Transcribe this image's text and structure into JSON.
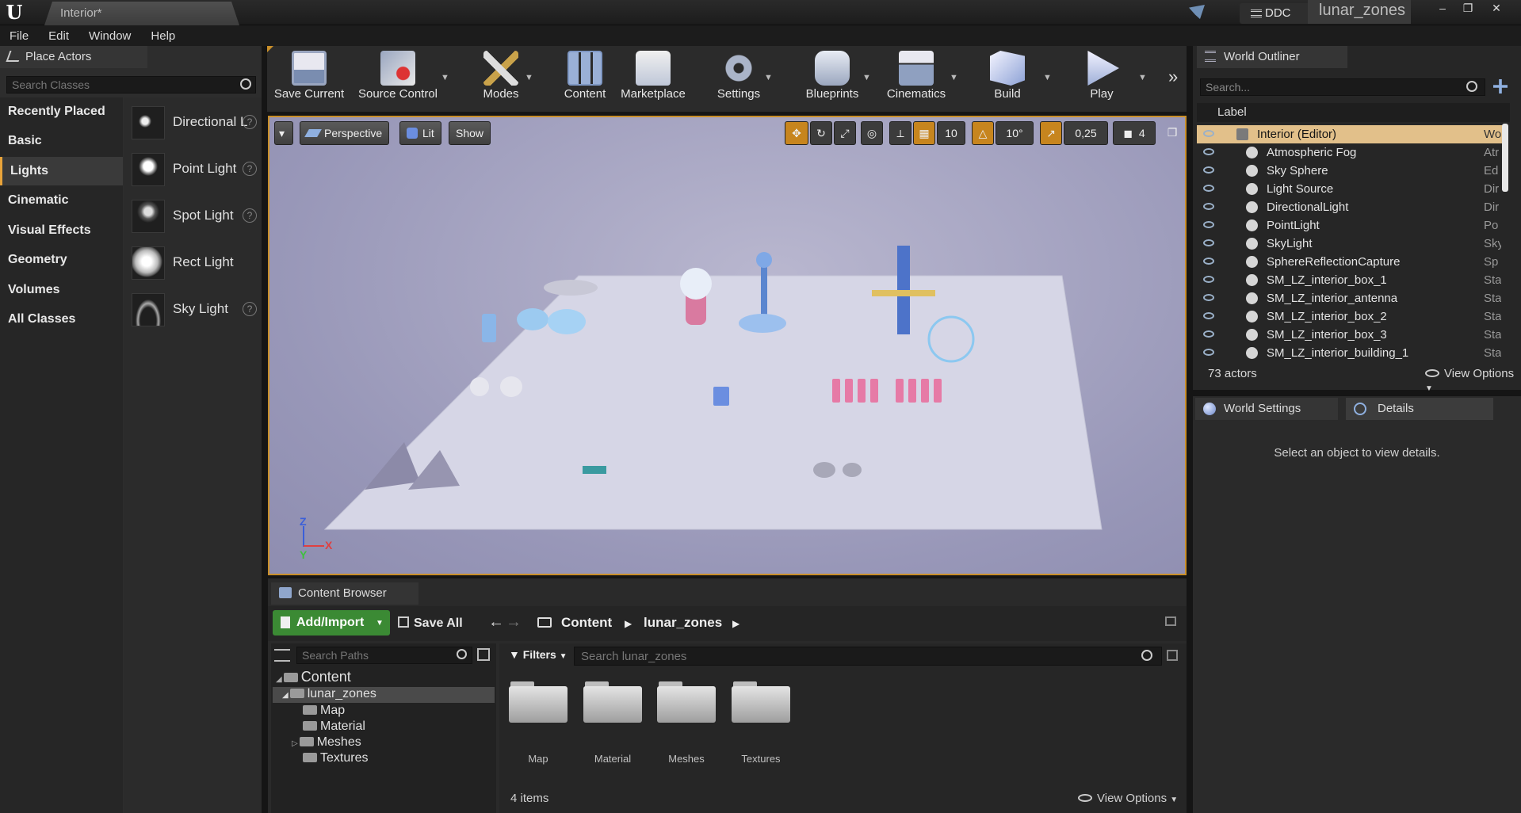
{
  "window": {
    "doc_tab": "Interior*",
    "ddc_label": "DDC",
    "project_name": "lunar_zones",
    "controls": [
      "–",
      "❐",
      "✕"
    ]
  },
  "menu": [
    "File",
    "Edit",
    "Window",
    "Help"
  ],
  "place_actors": {
    "tab_label": "Place Actors",
    "search_placeholder": "Search Classes",
    "categories": [
      "Recently Placed",
      "Basic",
      "Lights",
      "Cinematic",
      "Visual Effects",
      "Geometry",
      "Volumes",
      "All Classes"
    ],
    "active_category": "Lights",
    "items": [
      "Directional Light",
      "Point Light",
      "Spot Light",
      "Rect Light",
      "Sky Light"
    ]
  },
  "toolbar": {
    "buttons": [
      "Save Current",
      "Source Control",
      "Modes",
      "Content",
      "Marketplace",
      "Settings",
      "Blueprints",
      "Cinematics",
      "Build",
      "Play"
    ]
  },
  "viewport": {
    "perspective": "Perspective",
    "lit": "Lit",
    "show": "Show",
    "grid_snap": "10",
    "rotation_snap": "10°",
    "scale_snap": "0,25",
    "camera_speed": "4",
    "axis_labels": [
      "Z",
      "X",
      "Y"
    ]
  },
  "content_browser": {
    "tab_label": "Content Browser",
    "add_import": "Add/Import",
    "save_all": "Save All",
    "breadcrumb": [
      "Content",
      "lunar_zones"
    ],
    "search_paths_placeholder": "Search Paths",
    "filters": "Filters",
    "search_assets_placeholder": "Search lunar_zones",
    "tree": {
      "root": "Content",
      "selected": "lunar_zones",
      "children": [
        "Map",
        "Material",
        "Meshes",
        "Textures"
      ]
    },
    "folders": [
      "Map",
      "Material",
      "Meshes",
      "Textures"
    ],
    "item_count": "4 items",
    "view_options": "View Options"
  },
  "world_outliner": {
    "tab_label": "World Outliner",
    "search_placeholder": "Search...",
    "column_label": "Label",
    "rows": [
      {
        "label": "Interior (Editor)",
        "type": "World",
        "selected": true
      },
      {
        "label": "Atmospheric Fog",
        "type": "Atr"
      },
      {
        "label": "Sky Sphere",
        "type": "Ed"
      },
      {
        "label": "Light Source",
        "type": "Dir"
      },
      {
        "label": "DirectionalLight",
        "type": "Dir"
      },
      {
        "label": "PointLight",
        "type": "Po"
      },
      {
        "label": "SkyLight",
        "type": "Sky"
      },
      {
        "label": "SphereReflectionCapture",
        "type": "Sp"
      },
      {
        "label": "SM_LZ_interior_box_1",
        "type": "Sta"
      },
      {
        "label": "SM_LZ_interior_antenna",
        "type": "Sta"
      },
      {
        "label": "SM_LZ_interior_box_2",
        "type": "Sta"
      },
      {
        "label": "SM_LZ_interior_box_3",
        "type": "Sta"
      },
      {
        "label": "SM_LZ_interior_building_1",
        "type": "Sta"
      }
    ],
    "actor_count": "73 actors",
    "view_options": "View Options"
  },
  "details": {
    "world_settings_tab": "World Settings",
    "details_tab": "Details",
    "empty_message": "Select an object to view details."
  },
  "colors": {
    "accent_orange": "#c98f2a",
    "add_import_green": "#3b8a34",
    "selected_row": "#e2c08a"
  }
}
